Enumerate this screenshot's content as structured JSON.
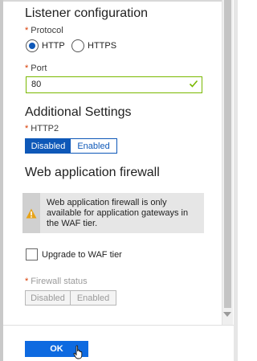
{
  "listener": {
    "section_title": "Listener configuration",
    "protocol_label": "Protocol",
    "protocol_options": [
      "HTTP",
      "HTTPS"
    ],
    "protocol_selected": "HTTP",
    "port_label": "Port",
    "port_value": "80"
  },
  "additional": {
    "section_title": "Additional Settings",
    "http2_label": "HTTP2",
    "http2_options": [
      "Disabled",
      "Enabled"
    ],
    "http2_selected": "Disabled"
  },
  "waf": {
    "section_title": "Web application firewall",
    "info_text": "Web application firewall is only available for application gateways in the WAF tier.",
    "upgrade_label": "Upgrade to WAF tier",
    "firewall_status_label": "Firewall status",
    "firewall_options": [
      "Disabled",
      "Enabled"
    ]
  },
  "footer": {
    "ok_label": "OK"
  },
  "colors": {
    "accent": "#0e58b8",
    "ok_button": "#0e6ae0",
    "required": "#d83b01",
    "valid": "#7ab800",
    "warning": "#e8a317"
  }
}
